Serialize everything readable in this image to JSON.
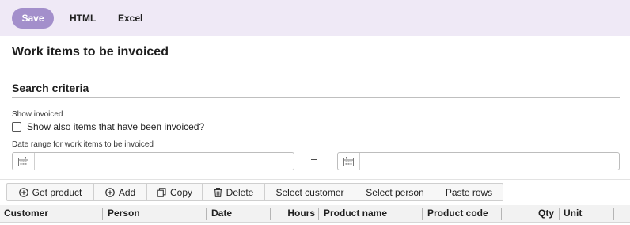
{
  "toolbar_top": {
    "save_label": "Save",
    "html_label": "HTML",
    "excel_label": "Excel"
  },
  "page": {
    "title": "Work items to be invoiced"
  },
  "search": {
    "section_title": "Search criteria",
    "show_invoiced_label": "Show invoiced",
    "show_invoiced_checkbox_label": "Show also items that have been invoiced?",
    "show_invoiced_checked": false,
    "date_range_label": "Date range for work items to be invoiced",
    "date_from_value": "",
    "date_to_value": "",
    "range_separator": "–"
  },
  "grid_toolbar": {
    "get_product": "Get product",
    "add": "Add",
    "copy": "Copy",
    "delete": "Delete",
    "select_customer": "Select customer",
    "select_person": "Select person",
    "paste_rows": "Paste rows"
  },
  "grid": {
    "columns": [
      "Customer",
      "Person",
      "Date",
      "Hours",
      "Product name",
      "Product code",
      "Qty",
      "Unit"
    ]
  }
}
